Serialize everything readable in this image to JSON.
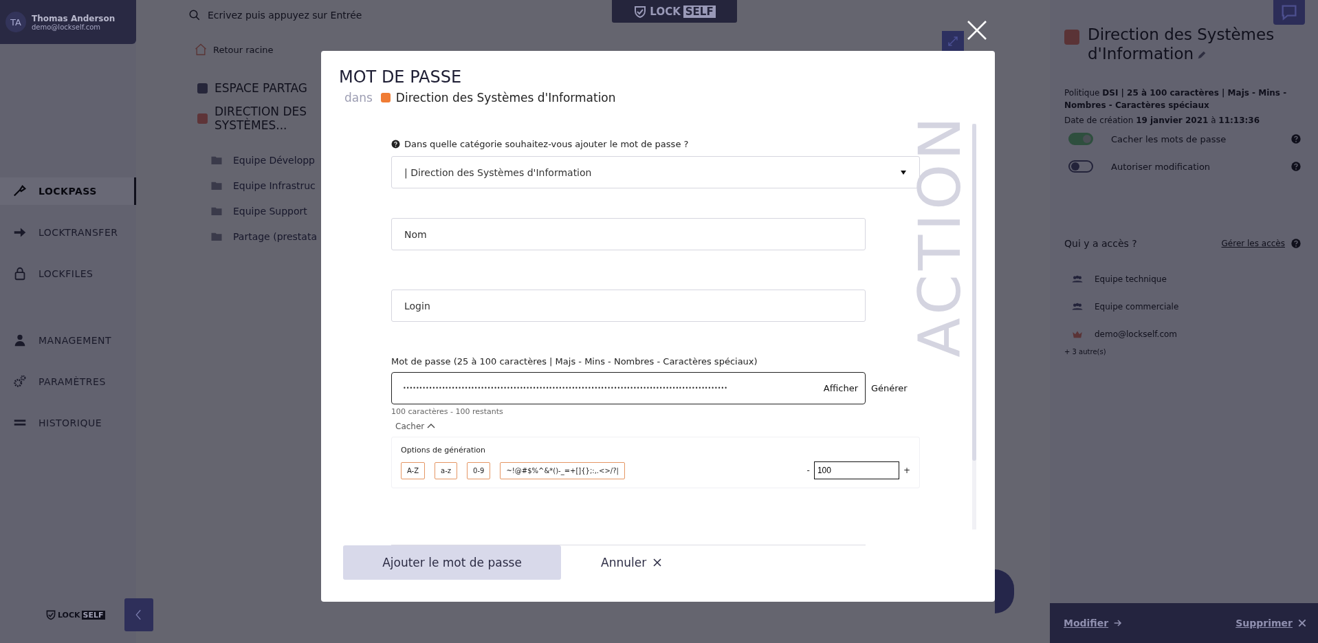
{
  "sidebar": {
    "user": {
      "initials": "TA",
      "name": "Thomas Anderson",
      "email": "demo@lockself.com"
    },
    "nav": [
      {
        "label": "LOCKPASS",
        "selected": true
      },
      {
        "label": "LOCKTRANSFER",
        "selected": false
      },
      {
        "label": "LOCKFILES",
        "selected": false
      },
      {
        "label": "MANAGEMENT",
        "selected": false
      },
      {
        "label": "PARAMÈTRES",
        "selected": false
      },
      {
        "label": "HISTORIQUE",
        "selected": false
      }
    ],
    "logo": {
      "lock": "LOCK",
      "self": "SELF"
    }
  },
  "main": {
    "search": {
      "placeholder": "Ecrivez puis appuyez sur Entrée"
    },
    "logo": {
      "lock": "LOCK",
      "self": "SELF"
    },
    "back_link": "Retour racine",
    "tree": [
      {
        "label": "ESPACE PARTAG",
        "color": "#26263a"
      },
      {
        "label": "DIRECTION DES SYSTÈMES...",
        "color": "#5e3438",
        "children": [
          {
            "label": "Equipe Développ"
          },
          {
            "label": "Equipe Infrastruc"
          },
          {
            "label": "Equipe Support"
          },
          {
            "label": "Partage (prestata"
          }
        ]
      }
    ]
  },
  "modal": {
    "title": "MOT DE PASSE",
    "context_prefix": "dans",
    "context": "Direction des Systèmes d'Information",
    "watermark": "ACTION",
    "category": {
      "label": "Dans quelle catégorie souhaitez-vous ajouter le mot de passe ?",
      "value": "| Direction des Systèmes d'Information"
    },
    "name_field": {
      "placeholder": "Nom"
    },
    "login_field": {
      "placeholder": "Login"
    },
    "password": {
      "label": "Mot de passe (25 à 100 caractères | Majs - Mins - Nombres - Caractères spéciaux)",
      "value": "••••••••••••••••••••••••••••••••••••••••••••••••••••••••••••••••••••••••••••••••••••••••••••••••••••",
      "show_button": "Afficher",
      "generate_button": "Générer",
      "counter": "100 caractères - 100 restants",
      "toggle": "Cacher",
      "expanded": true
    },
    "generation": {
      "title": "Options de génération",
      "charsets": [
        {
          "label": "A-Z",
          "selected": true
        },
        {
          "label": "a-z",
          "selected": true
        },
        {
          "label": "0-9",
          "selected": true
        },
        {
          "label": "~!@#$%^&*()-_=+[]{};:,.<>/?|",
          "selected": true
        }
      ],
      "minus": "-",
      "length": "100",
      "plus": "+"
    },
    "footer": {
      "submit": "Ajouter le mot de passe",
      "cancel": "Annuler"
    }
  },
  "detail": {
    "title": "Direction des Systèmes d'Information",
    "policy": "Politique **DSI | 25 à 100 caractères | Majs - Mins - Nombres - Caractères spéciaux**",
    "date": "Date de création **19 janvier 2021** à **11:13:36**",
    "toggles": [
      {
        "label": "Cacher les mots de passe",
        "on": true
      },
      {
        "label": "Autoriser modification",
        "on": false
      }
    ],
    "access_title": "Qui y a accès ?",
    "manage_link": "Gérer les accès",
    "access": [
      {
        "kind": "group",
        "label": "Equipe technique"
      },
      {
        "kind": "group",
        "label": "Equipe commerciale"
      },
      {
        "kind": "owner",
        "label": "demo@lockself.com"
      }
    ],
    "more": "+ 3 autre(s)",
    "edit": "Modifier",
    "delete": "Supprimer"
  }
}
